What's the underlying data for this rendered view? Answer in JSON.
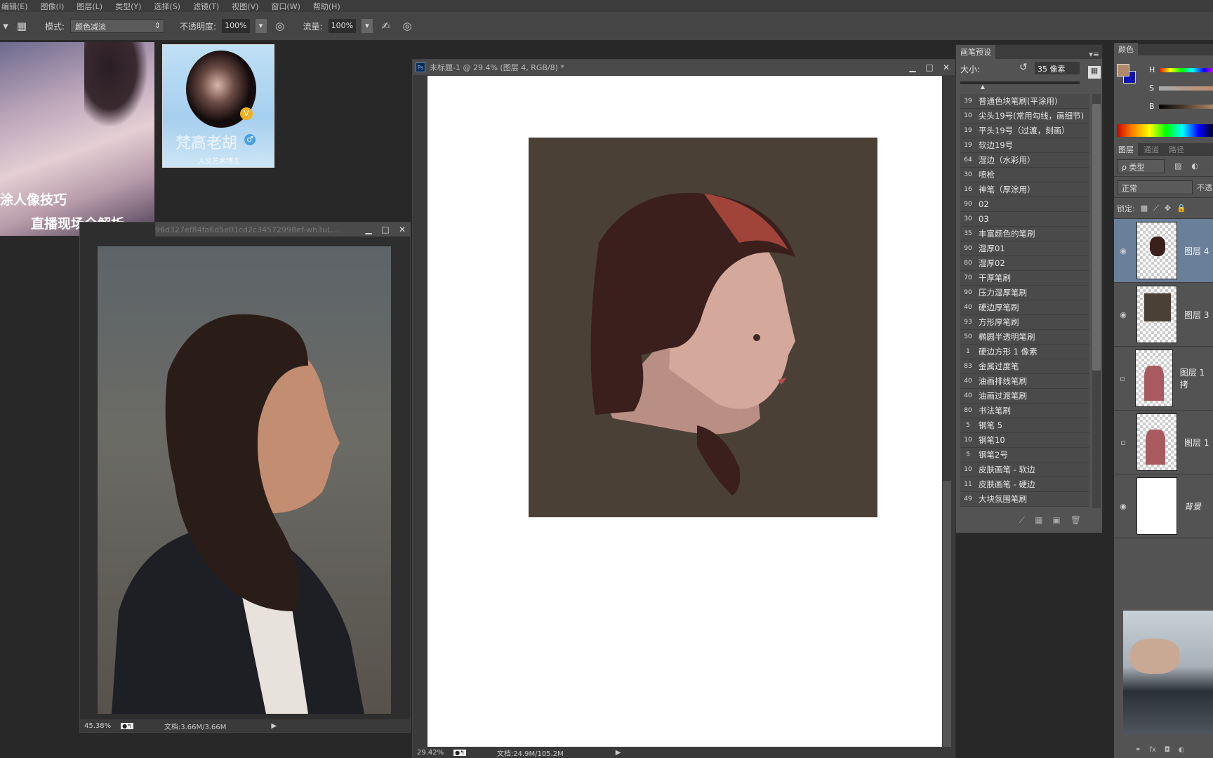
{
  "menu": [
    "编辑(E)",
    "图像(I)",
    "图层(L)",
    "类型(Y)",
    "选择(S)",
    "滤镜(T)",
    "视图(V)",
    "窗口(W)",
    "帮助(H)"
  ],
  "toolbar": {
    "mode_label": "模式:",
    "mode_value": "颜色减淡",
    "opacity_label": "不透明度:",
    "opacity_value": "100%",
    "flow_label": "流量:",
    "flow_value": "100%"
  },
  "promo": {
    "line1": "涂人像技巧",
    "line2": "直播现场全解析"
  },
  "profile": {
    "name": "梵高老胡",
    "subtitle": "人文艺术博主",
    "badge": "V"
  },
  "reference_window": {
    "title": "96d327ef84fa6d5e01cd2c34572998ef-wh3uL...",
    "zoom": "45.38%",
    "doc": "文档:3.66M/3.66M"
  },
  "main_window": {
    "title": "未标题-1 @ 29.4% (图层 4, RGB/8) *",
    "zoom": "29.42%",
    "doc": "文档:24.9M/105.2M"
  },
  "brush_panel": {
    "tab": "画笔预设",
    "size_label": "大小:",
    "size_value": "35 像素",
    "size_fraction": 0.17,
    "brushes": [
      {
        "size": "39",
        "name": "普通色块笔刷(平涂用)"
      },
      {
        "size": "10",
        "name": "尖头19号(常用勾线，画细节)"
      },
      {
        "size": "19",
        "name": "平头19号（过渡，刻画）"
      },
      {
        "size": "19",
        "name": "软边19号"
      },
      {
        "size": "64",
        "name": "湿边（水彩用）"
      },
      {
        "size": "30",
        "name": "喷枪"
      },
      {
        "size": "16",
        "name": "神笔（厚涂用）"
      },
      {
        "size": "90",
        "name": "02"
      },
      {
        "size": "30",
        "name": "03"
      },
      {
        "size": "35",
        "name": "丰富颜色的笔刷"
      },
      {
        "size": "90",
        "name": "湿厚01"
      },
      {
        "size": "80",
        "name": "湿厚02"
      },
      {
        "size": "70",
        "name": "干厚笔刷"
      },
      {
        "size": "90",
        "name": "压力湿厚笔刷"
      },
      {
        "size": "40",
        "name": "硬边厚笔刷"
      },
      {
        "size": "93",
        "name": "方形厚笔刷"
      },
      {
        "size": "50",
        "name": "椭圆半透明笔刷"
      },
      {
        "size": "1",
        "name": "硬边方形 1 像素"
      },
      {
        "size": "83",
        "name": "金属过度笔"
      },
      {
        "size": "40",
        "name": "油画排线笔刷"
      },
      {
        "size": "40",
        "name": "油画过渡笔刷"
      },
      {
        "size": "80",
        "name": "书法笔刷"
      },
      {
        "size": "5",
        "name": "钢笔 5"
      },
      {
        "size": "10",
        "name": "钢笔10"
      },
      {
        "size": "5",
        "name": "钢笔2号"
      },
      {
        "size": "10",
        "name": "皮肤画笔 - 软边"
      },
      {
        "size": "11",
        "name": "皮肤画笔 - 硬边"
      },
      {
        "size": "49",
        "name": "大块氛围笔刷"
      }
    ]
  },
  "color_panel": {
    "tab": "颜色",
    "h": "H",
    "s": "S",
    "b": "B",
    "foreground": "#b08a68",
    "background": "#1010b0"
  },
  "layers_panel": {
    "tabs": [
      "图层",
      "通道",
      "路径"
    ],
    "filter": "ρ 类型",
    "blend": "正常",
    "opacity_label": "不透",
    "lock_label": "锁定:",
    "layers": [
      {
        "name": "图层 4",
        "visible": true,
        "selected": true
      },
      {
        "name": "图层 3",
        "visible": true
      },
      {
        "name": "图层 1 拷",
        "visible": false
      },
      {
        "name": "图层 1",
        "visible": false
      },
      {
        "name": "背景",
        "visible": true
      }
    ]
  },
  "colors": {
    "canvas_bg": "#4a4036",
    "selected_layer": "#6a7f99"
  }
}
